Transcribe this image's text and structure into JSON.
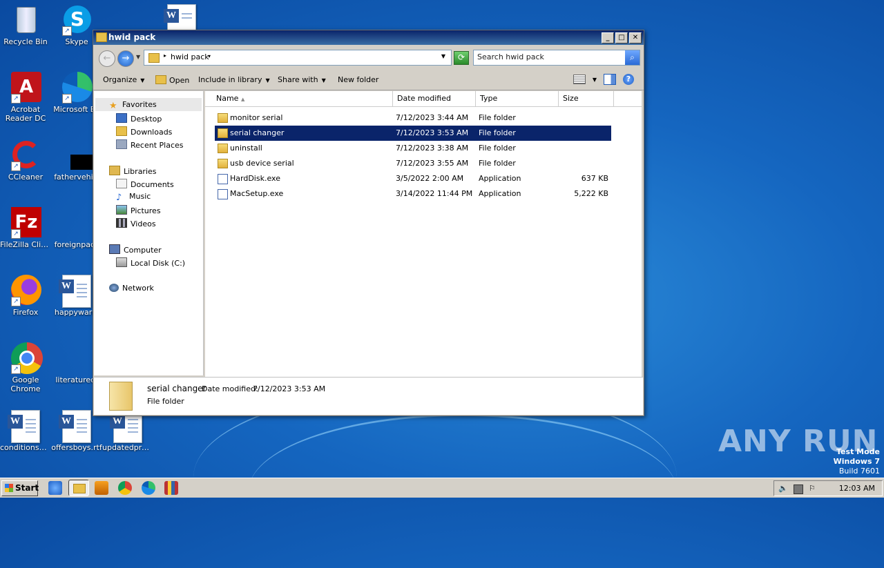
{
  "desktop": {
    "icons": [
      {
        "label": "Recycle Bin",
        "icon": "recycle-bin-icon"
      },
      {
        "label": "Skype",
        "icon": "skype-icon"
      },
      {
        "label": "Acrobat Reader DC",
        "icon": "acrobat-icon"
      },
      {
        "label": "Microsoft Ed",
        "icon": "edge-icon"
      },
      {
        "label": "CCleaner",
        "icon": "ccleaner-icon"
      },
      {
        "label": "fathervehicl",
        "icon": "black-file-icon"
      },
      {
        "label": "FileZilla Client",
        "icon": "filezilla-icon"
      },
      {
        "label": "foreignpack",
        "icon": "file-icon"
      },
      {
        "label": "Firefox",
        "icon": "firefox-icon"
      },
      {
        "label": "happywarni",
        "icon": "word-doc-icon"
      },
      {
        "label": "Google Chrome",
        "icon": "chrome-icon"
      },
      {
        "label": "literatured.",
        "icon": "file-icon"
      },
      {
        "label": "conditionsdi...",
        "icon": "word-doc-icon"
      },
      {
        "label": "offersboys.rtf",
        "icon": "word-doc-icon"
      },
      {
        "label": "updatedpro...",
        "icon": "word-doc-icon"
      }
    ],
    "watermark": "ANY RUN",
    "test_mode": {
      "line1": "Test Mode",
      "line2": "Windows 7",
      "line3": "Build 7601"
    }
  },
  "window": {
    "title": "hwid pack",
    "address": "hwid pack",
    "search_placeholder": "Search hwid pack",
    "toolbar": {
      "organize": "Organize",
      "open": "Open",
      "include_in_library": "Include in library",
      "share_with": "Share with",
      "new_folder": "New folder"
    },
    "nav": {
      "favorites": "Favorites",
      "desktop": "Desktop",
      "downloads": "Downloads",
      "recent_places": "Recent Places",
      "libraries": "Libraries",
      "documents": "Documents",
      "music": "Music",
      "pictures": "Pictures",
      "videos": "Videos",
      "computer": "Computer",
      "local_disk": "Local Disk (C:)",
      "network": "Network"
    },
    "columns": {
      "name": "Name",
      "date": "Date modified",
      "type": "Type",
      "size": "Size"
    },
    "files": [
      {
        "name": "monitor serial",
        "date": "7/12/2023 3:44 AM",
        "type": "File folder",
        "size": "",
        "kind": "folder"
      },
      {
        "name": "serial changer",
        "date": "7/12/2023 3:53 AM",
        "type": "File folder",
        "size": "",
        "kind": "folder",
        "selected": true
      },
      {
        "name": "uninstall",
        "date": "7/12/2023 3:38 AM",
        "type": "File folder",
        "size": "",
        "kind": "folder"
      },
      {
        "name": "usb device serial",
        "date": "7/12/2023 3:55 AM",
        "type": "File folder",
        "size": "",
        "kind": "folder"
      },
      {
        "name": "HardDisk.exe",
        "date": "3/5/2022 2:00 AM",
        "type": "Application",
        "size": "637 KB",
        "kind": "exe"
      },
      {
        "name": "MacSetup.exe",
        "date": "3/14/2022 11:44 PM",
        "type": "Application",
        "size": "5,222 KB",
        "kind": "exe"
      }
    ],
    "details": {
      "name": "serial changer",
      "date_label": "Date modified:",
      "date": "7/12/2023 3:53 AM",
      "type": "File folder"
    }
  },
  "taskbar": {
    "start": "Start",
    "clock": "12:03 AM"
  }
}
